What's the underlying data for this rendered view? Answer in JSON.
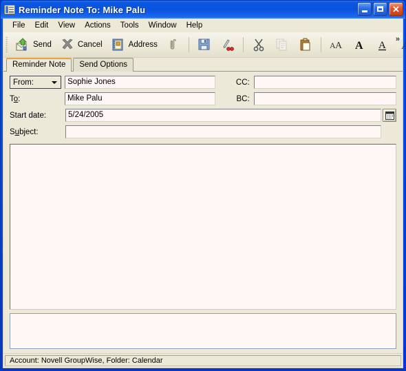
{
  "window": {
    "title": "Reminder Note To: Mike Palu",
    "icon": "note-window-icon",
    "minimize_label": "Minimize",
    "maximize_label": "Maximize",
    "close_label": "Close"
  },
  "menubar": {
    "items": [
      {
        "label": "File"
      },
      {
        "label": "Edit"
      },
      {
        "label": "View"
      },
      {
        "label": "Actions"
      },
      {
        "label": "Tools"
      },
      {
        "label": "Window"
      },
      {
        "label": "Help"
      }
    ]
  },
  "toolbar": {
    "send_label": "Send",
    "cancel_label": "Cancel",
    "address_label": "Address",
    "attach_icon": "paperclip-icon",
    "save_icon": "floppy-save-icon",
    "spellcheck_icon": "spell-check-icon",
    "cut_icon": "scissors-cut-icon",
    "copy_icon": "copy-pages-icon",
    "paste_icon": "clipboard-paste-icon",
    "font_icon": "font-AA-icon",
    "bold_icon": "bold-A-icon",
    "underline_icon": "underline-A-icon",
    "italic_icon": "italic-A-icon",
    "overflow_label": "»"
  },
  "tabs": [
    {
      "label": "Reminder Note",
      "active": true
    },
    {
      "label": "Send Options",
      "active": false
    }
  ],
  "form": {
    "from": {
      "combo_label": "From:",
      "value": "Sophie Jones",
      "placeholder": ""
    },
    "to": {
      "label_pre": "T",
      "label_accel": "o",
      "label_post": ":",
      "value": "Mike Palu",
      "placeholder": ""
    },
    "cc": {
      "label": "CC:",
      "value": "",
      "placeholder": ""
    },
    "bc": {
      "label": "BC:",
      "value": "",
      "placeholder": ""
    },
    "start_date": {
      "label": "Start date:",
      "value": "5/24/2005",
      "placeholder": "",
      "picker_icon": "calendar-icon"
    },
    "subject": {
      "label_pre": "S",
      "label_accel": "u",
      "label_post": "bject:",
      "value": "",
      "placeholder": ""
    },
    "message_body": {
      "value": "",
      "placeholder": ""
    },
    "attachments": {
      "value": "",
      "placeholder": ""
    }
  },
  "statusbar": {
    "text": "Account: Novell GroupWise,  Folder: Calendar"
  },
  "colors": {
    "title_blue": "#0a52dd",
    "frame_blue": "#0b35c8",
    "face": "#ece9d8",
    "field_bg": "#fff6f6",
    "active_tab_accent": "#e8a33d",
    "close_red": "#e2552a"
  }
}
